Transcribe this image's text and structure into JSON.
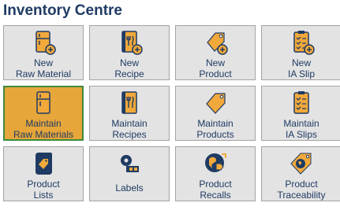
{
  "header": {
    "title": "Inventory Centre"
  },
  "colors": {
    "accent": "#f2a93b",
    "dark": "#1f3b63",
    "tile": "#e3e3e3",
    "selected": "#e6a63a"
  },
  "tiles": [
    {
      "label": "New\nRaw Material",
      "icon": "fridge-add-icon"
    },
    {
      "label": "New\nRecipe",
      "icon": "recipe-book-add-icon"
    },
    {
      "label": "New\nProduct",
      "icon": "price-tag-add-icon"
    },
    {
      "label": "New\nIA Slip",
      "icon": "checklist-add-icon"
    },
    {
      "label": "Maintain\nRaw Materials",
      "icon": "fridge-icon",
      "selected": true
    },
    {
      "label": "Maintain\nRecipes",
      "icon": "recipe-book-icon"
    },
    {
      "label": "Maintain\nProducts",
      "icon": "price-tag-icon"
    },
    {
      "label": "Maintain\nIA Slips",
      "icon": "checklist-icon"
    },
    {
      "label": "Product\nLists",
      "icon": "tag-list-icon"
    },
    {
      "label": "Labels",
      "icon": "label-roll-icon"
    },
    {
      "label": "Product\nRecalls",
      "icon": "recall-icon"
    },
    {
      "label": "Product\nTraceability",
      "icon": "globe-tag-icon"
    }
  ]
}
